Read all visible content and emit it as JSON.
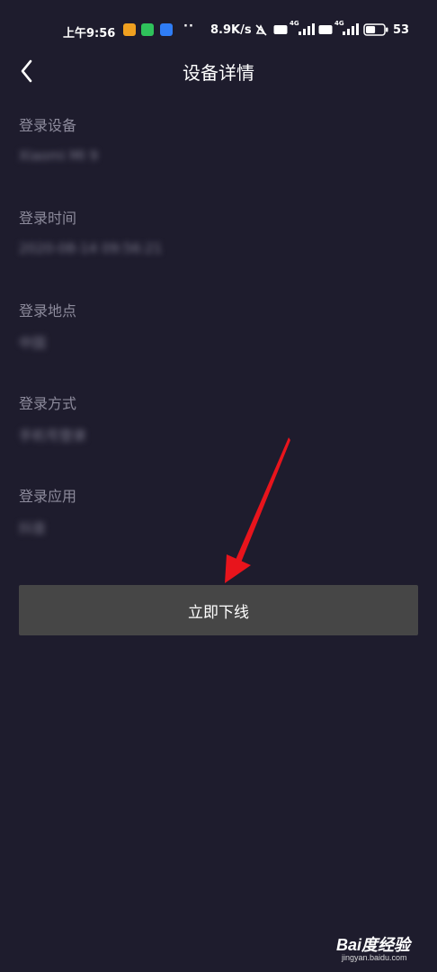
{
  "status_bar": {
    "time": "上午9:56",
    "overflow_dots": "··",
    "net_speed": "8.9K/s",
    "sim1_label": "4G",
    "sim2_label": "4G",
    "battery_pct": "53",
    "battery_level": 0.53,
    "app_icon_colors": [
      "#f0a020",
      "#2fc25b",
      "#2f7df6"
    ]
  },
  "nav": {
    "back_icon": "chevron-left-icon",
    "title": "设备详情"
  },
  "fields": [
    {
      "label": "登录设备",
      "value": "Xiaomi MI 9"
    },
    {
      "label": "登录时间",
      "value": "2020-08-14 09:56:21"
    },
    {
      "label": "登录地点",
      "value": "中国"
    },
    {
      "label": "登录方式",
      "value": "手机号登录"
    },
    {
      "label": "登录应用",
      "value": "抖音"
    }
  ],
  "action": {
    "logout_label": "立即下线"
  },
  "annotation": {
    "arrow_color": "#e8141c"
  },
  "watermark": {
    "main": "Bai度经验",
    "sub": "jingyan.baidu.com"
  }
}
